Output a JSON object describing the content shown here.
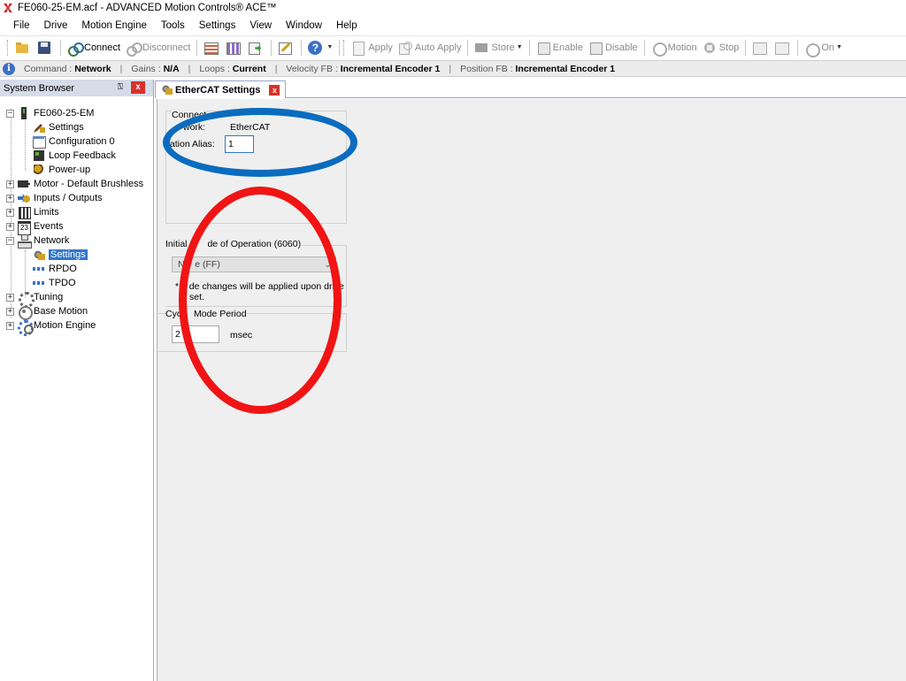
{
  "window": {
    "title": "FE060-25-EM.acf - ADVANCED Motion Controls® ACE™"
  },
  "menu": [
    "File",
    "Drive",
    "Motion Engine",
    "Tools",
    "Settings",
    "View",
    "Window",
    "Help"
  ],
  "toolbar": {
    "connect_label": "Connect",
    "disconnect_label": "Disconnect",
    "apply_label": "Apply",
    "auto_apply_label": "Auto Apply",
    "store_label": "Store",
    "enable_label": "Enable",
    "disable_label": "Disable",
    "motion_label": "Motion",
    "stop_label": "Stop",
    "on_label": "On"
  },
  "status": {
    "command_label": "Command :",
    "command_value": "Network",
    "gains_label": "Gains :",
    "gains_value": "N/A",
    "loops_label": "Loops :",
    "loops_value": "Current",
    "velocity_label": "Velocity FB :",
    "velocity_value": "Incremental Encoder 1",
    "position_label": "Position FB :",
    "position_value": "Incremental Encoder 1",
    "separator": "|"
  },
  "system_browser": {
    "title": "System Browser",
    "pin_glyph": "⍂",
    "close_glyph": "x",
    "tree": [
      {
        "label": "FE060-25-EM",
        "icon": "drive-icon"
      },
      {
        "label": "Settings",
        "icon": "settings-icon"
      },
      {
        "label": "Configuration 0",
        "icon": "configuration-icon"
      },
      {
        "label": "Loop Feedback",
        "icon": "loop-feedback-icon"
      },
      {
        "label": "Power-up",
        "icon": "power-up-icon"
      },
      {
        "label": "Motor - Default Brushless",
        "icon": "motor-icon"
      },
      {
        "label": "Inputs / Outputs",
        "icon": "inputs-outputs-icon"
      },
      {
        "label": "Limits",
        "icon": "limits-icon"
      },
      {
        "label": "Events",
        "icon": "events-icon"
      },
      {
        "label": "Network",
        "icon": "network-icon"
      },
      {
        "label": "Settings",
        "icon": "network-settings-icon",
        "selected": true
      },
      {
        "label": "RPDO",
        "icon": "rpdo-icon"
      },
      {
        "label": "TPDO",
        "icon": "tpdo-icon"
      },
      {
        "label": "Tuning",
        "icon": "tuning-icon"
      },
      {
        "label": "Base Motion",
        "icon": "base-motion-icon"
      },
      {
        "label": "Motion Engine",
        "icon": "motion-engine-icon"
      }
    ]
  },
  "tab": {
    "title": "EtherCAT Settings",
    "close_glyph": "x"
  },
  "ethercat_settings": {
    "connection_group_title": "Connect",
    "network_label": "Network:",
    "network_label_visible": "work:",
    "network_value": "EtherCAT",
    "station_alias_label": "Station Alias:",
    "station_alias_label_visible": "tation Alias:",
    "station_alias_value": "1",
    "mode_group_title": "Initial Mode of Operation (6060)",
    "mode_group_title_visible_a": "Initial ",
    "mode_group_title_visible_b": "de of Operation (6060)",
    "mode_value_visible": "N    e (FF)",
    "mode_note_line1_visible": "*    de changes will be applied upon drive",
    "mode_note_line2_visible": "set.",
    "cyclic_group_title_visible_a": "Cyc",
    "cyclic_group_title_visible_b": " Mode Period",
    "cyclic_value_visible": "2",
    "cyclic_unit": "msec"
  },
  "colors": {
    "annotation_blue": "#0a6cbf",
    "annotation_red": "#f01414",
    "selection": "#3177c8",
    "close_button": "#d9302a"
  }
}
